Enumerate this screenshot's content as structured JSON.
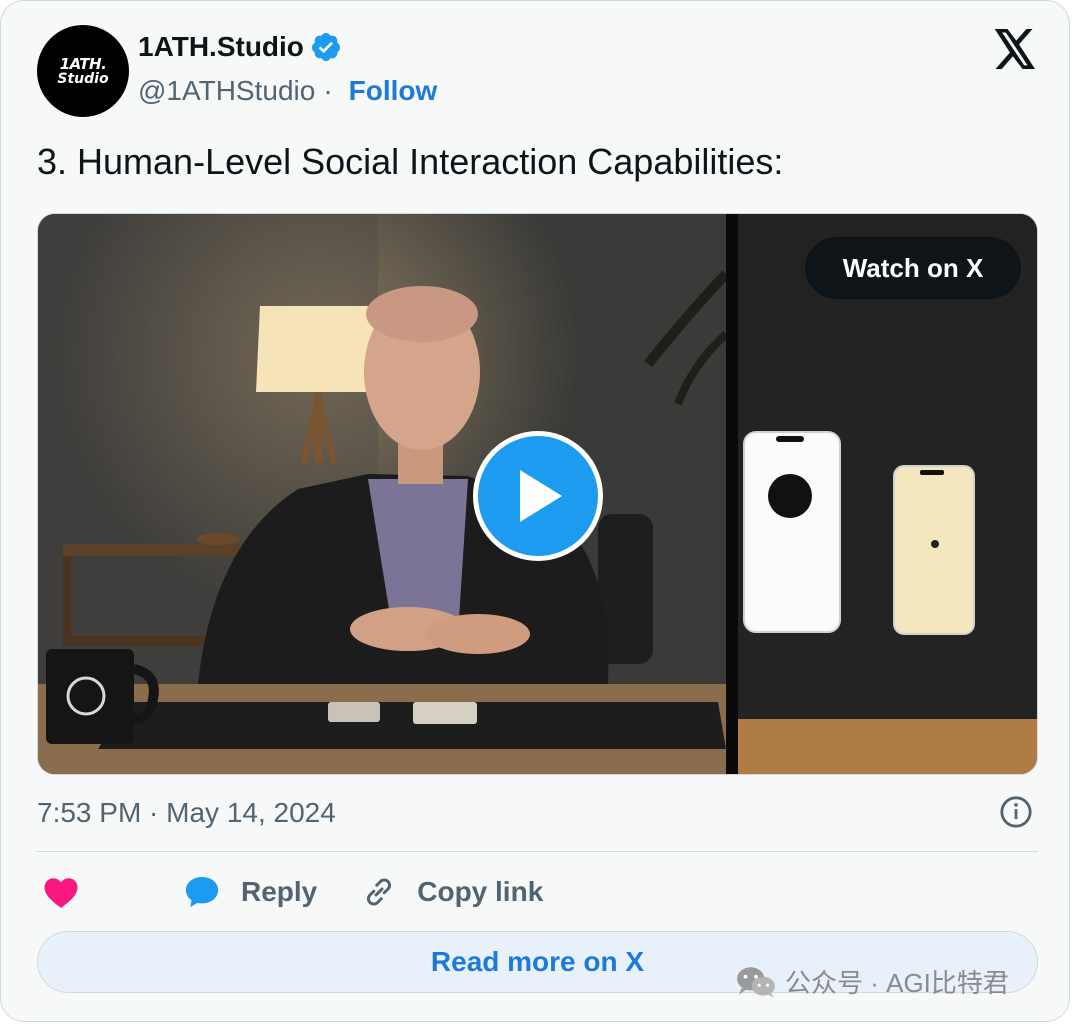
{
  "author": {
    "name": "1ATH.Studio",
    "handle": "@1ATHStudio",
    "separator": "·",
    "follow_label": "Follow",
    "avatar_text_line1": "1ATH.",
    "avatar_text_line2": "Studio",
    "verified": true
  },
  "tweet": {
    "text": "3. Human-Level Social Interaction Capabilities:",
    "timestamp": "7:53 PM · May 14, 2024"
  },
  "media": {
    "watch_label": "Watch on X",
    "type": "video"
  },
  "actions": {
    "reply_label": "Reply",
    "copy_link_label": "Copy link"
  },
  "footer": {
    "read_more_label": "Read more on X"
  },
  "watermark": {
    "text": "公众号 · AGI比特君"
  },
  "colors": {
    "accent": "#1d9bf0",
    "link": "#1d7ad6",
    "heart": "#f91880",
    "text_secondary": "#536471",
    "card_bg": "#f7f9f9"
  }
}
